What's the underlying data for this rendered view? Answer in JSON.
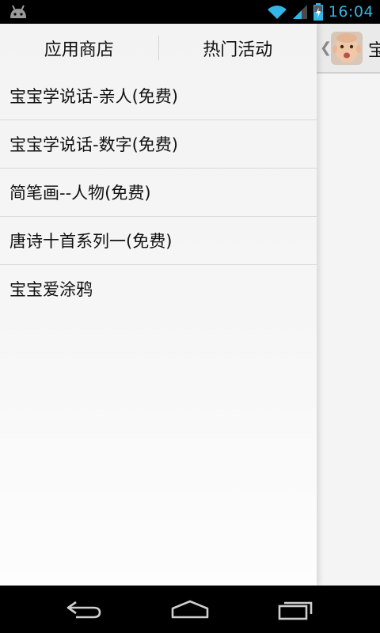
{
  "status_bar": {
    "time": "16:04",
    "clock_color": "#33b5e5",
    "icons": [
      "android-debug-icon",
      "wifi-icon",
      "signal-icon",
      "battery-charging-icon"
    ]
  },
  "drawer": {
    "tabs": [
      {
        "label": "应用商店"
      },
      {
        "label": "热门活动"
      }
    ],
    "items": [
      {
        "label": "宝宝学说话-亲人(免费)"
      },
      {
        "label": "宝宝学说话-数字(免费)"
      },
      {
        "label": "简笔画--人物(免费)"
      },
      {
        "label": "唐诗十首系列一(免费)"
      },
      {
        "label": "宝宝爱涂鸦"
      }
    ]
  },
  "content_panel": {
    "header_title": "宝",
    "back_icon": "chevron-left-icon",
    "avatar_icon": "baby-avatar"
  },
  "nav_bar": {
    "buttons": [
      "back-icon",
      "home-icon",
      "recent-apps-icon"
    ]
  }
}
